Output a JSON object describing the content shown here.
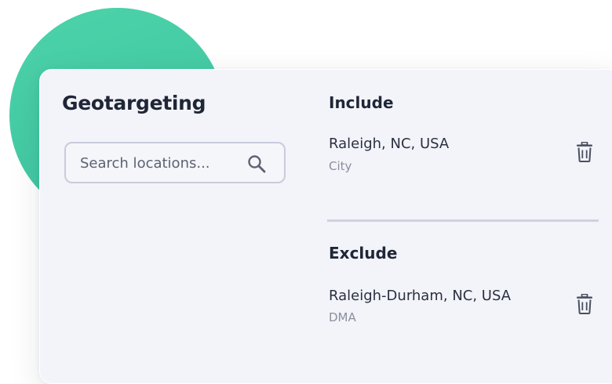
{
  "panel": {
    "title": "Geotargeting",
    "search": {
      "placeholder": "Search locations..."
    },
    "include": {
      "heading": "Include",
      "items": [
        {
          "name": "Raleigh, NC, USA",
          "type": "City"
        }
      ]
    },
    "exclude": {
      "heading": "Exclude",
      "items": [
        {
          "name": "Raleigh-Durham, NC, USA",
          "type": "DMA"
        }
      ]
    }
  },
  "colors": {
    "accent_blob": "#45cba6",
    "card_background": "#f3f4f9",
    "text_primary": "#1f2637",
    "text_secondary": "#8a8fa0"
  },
  "icons": [
    "search-icon",
    "trash-icon"
  ]
}
